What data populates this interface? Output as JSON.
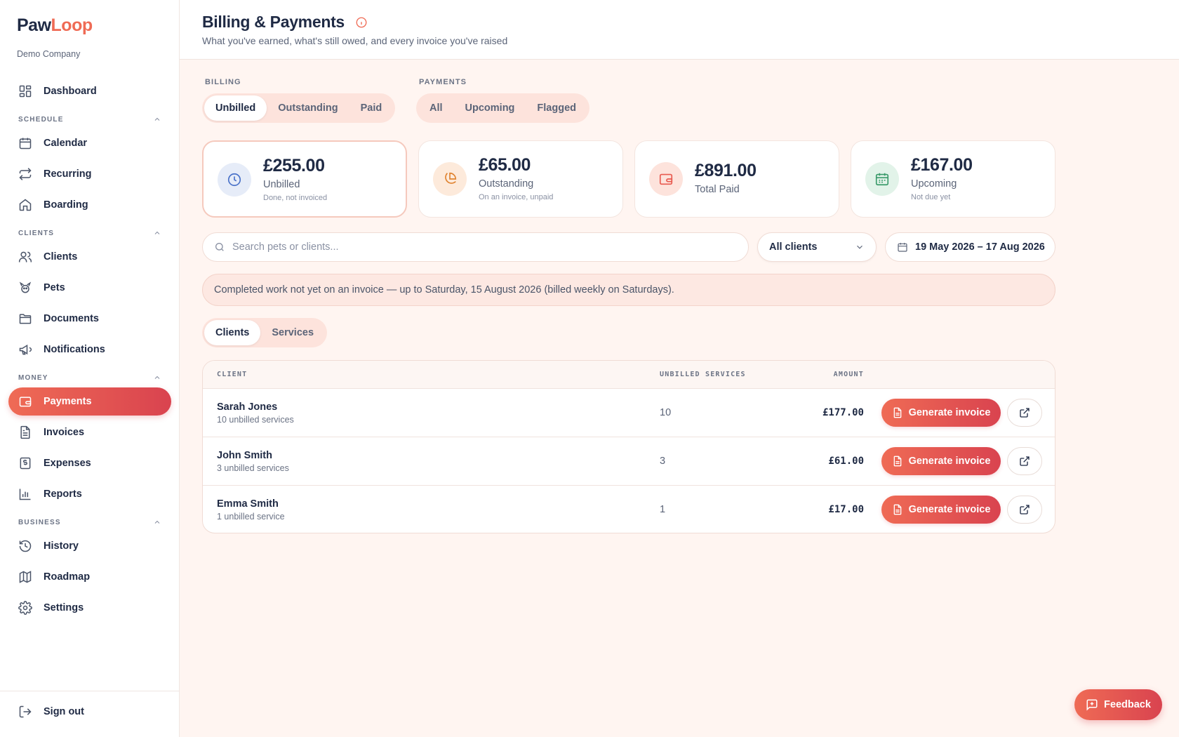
{
  "app": {
    "logo_part1": "Paw",
    "logo_part2": "Loop",
    "company": "Demo Company"
  },
  "sidebar": {
    "dashboard": "Dashboard",
    "sections": {
      "schedule": "SCHEDULE",
      "clients": "CLIENTS",
      "money": "MONEY",
      "business": "BUSINESS"
    },
    "items": {
      "calendar": "Calendar",
      "recurring": "Recurring",
      "boarding": "Boarding",
      "clients": "Clients",
      "pets": "Pets",
      "documents": "Documents",
      "notifications": "Notifications",
      "payments": "Payments",
      "invoices": "Invoices",
      "expenses": "Expenses",
      "reports": "Reports",
      "history": "History",
      "roadmap": "Roadmap",
      "settings": "Settings"
    },
    "sign_out": "Sign out"
  },
  "header": {
    "title": "Billing & Payments",
    "subtitle": "What you've earned, what's still owed, and every invoice you've raised"
  },
  "billing_tabs": {
    "label": "BILLING",
    "tabs": [
      "Unbilled",
      "Outstanding",
      "Paid"
    ],
    "active": "Unbilled"
  },
  "payment_tabs": {
    "label": "PAYMENTS",
    "tabs": [
      "All",
      "Upcoming",
      "Flagged"
    ]
  },
  "stats": [
    {
      "amount": "£255.00",
      "label": "Unbilled",
      "hint": "Done, not invoiced",
      "icon": "clock-icon",
      "color": "#4a72c9",
      "bg": "#e6ecf8"
    },
    {
      "amount": "£65.00",
      "label": "Outstanding",
      "hint": "On an invoice, unpaid",
      "icon": "pie-chart-icon",
      "color": "#e0822e",
      "bg": "#fdeadb"
    },
    {
      "amount": "£891.00",
      "label": "Total Paid",
      "hint": "",
      "icon": "wallet-icon",
      "color": "#e85a4f",
      "bg": "#fde3dc"
    },
    {
      "amount": "£167.00",
      "label": "Upcoming",
      "hint": "Not due yet",
      "icon": "calendar-icon",
      "color": "#3a9a6a",
      "bg": "#e2f3e9"
    }
  ],
  "filters": {
    "search_placeholder": "Search pets or clients...",
    "client_select": "All clients",
    "date_range": "19 May 2026 – 17 Aug 2026"
  },
  "notice": "Completed work not yet on an invoice — up to Saturday, 15 August 2026 (billed weekly on Saturdays).",
  "view_tabs": {
    "tabs": [
      "Clients",
      "Services"
    ],
    "active": "Clients"
  },
  "table": {
    "columns": [
      "CLIENT",
      "UNBILLED SERVICES",
      "AMOUNT"
    ],
    "rows": [
      {
        "name": "Sarah Jones",
        "sub": "10 unbilled services",
        "count": "10",
        "amount": "£177.00"
      },
      {
        "name": "John Smith",
        "sub": "3 unbilled services",
        "count": "3",
        "amount": "£61.00"
      },
      {
        "name": "Emma Smith",
        "sub": "1 unbilled service",
        "count": "1",
        "amount": "£17.00"
      }
    ],
    "action_label": "Generate invoice"
  },
  "feedback": "Feedback",
  "colors": {
    "accent": "#ef6b55",
    "accent_dark": "#d9434f",
    "text": "#1f2a44",
    "background": "#fff5f1"
  }
}
